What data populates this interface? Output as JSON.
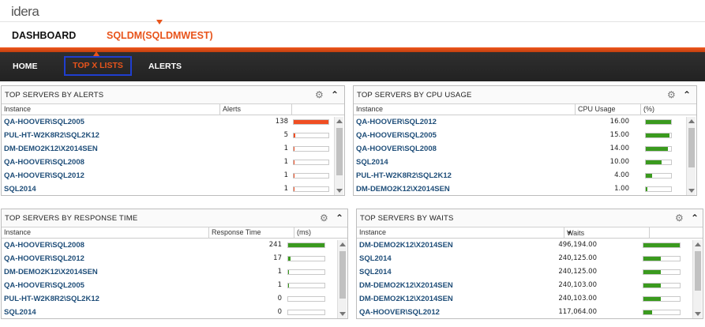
{
  "brand": {
    "logo": "idera"
  },
  "subheader": {
    "dashboard_label": "DASHBOARD",
    "instance_label": "SQLDM(SQLDMWEST)"
  },
  "nav": {
    "home": "HOME",
    "topx": "TOP X LISTS",
    "alerts": "ALERTS"
  },
  "colors": {
    "accent": "#e8541b",
    "alert_bar": "#f04e23",
    "good_bar": "#3a9a1e",
    "link": "#1f4e79"
  },
  "icons": {
    "gear": "gear-icon",
    "collapse": "chevron-up-icon",
    "sort": "sort-down-icon"
  },
  "panels": {
    "alerts": {
      "title": "TOP SERVERS BY ALERTS",
      "columns": [
        "Instance",
        "Alerts"
      ],
      "max": 138,
      "rows": [
        {
          "instance": "QA-HOOVER\\SQL2005",
          "value": "138",
          "num": 138
        },
        {
          "instance": "PUL-HT-W2K8R2\\SQL2K12",
          "value": "5",
          "num": 5
        },
        {
          "instance": "DM-DEMO2K12\\X2014SEN",
          "value": "1",
          "num": 1
        },
        {
          "instance": "QA-HOOVER\\SQL2008",
          "value": "1",
          "num": 1
        },
        {
          "instance": "QA-HOOVER\\SQL2012",
          "value": "1",
          "num": 1
        },
        {
          "instance": "SQL2014",
          "value": "1",
          "num": 1
        }
      ]
    },
    "cpu": {
      "title": "TOP SERVERS BY CPU USAGE",
      "columns": [
        "Instance",
        "CPU Usage",
        "(%)"
      ],
      "max": 16,
      "rows": [
        {
          "instance": "QA-HOOVER\\SQL2012",
          "value": "16.00",
          "num": 16
        },
        {
          "instance": "QA-HOOVER\\SQL2005",
          "value": "15.00",
          "num": 15
        },
        {
          "instance": "QA-HOOVER\\SQL2008",
          "value": "14.00",
          "num": 14
        },
        {
          "instance": "SQL2014",
          "value": "10.00",
          "num": 10
        },
        {
          "instance": "PUL-HT-W2K8R2\\SQL2K12",
          "value": "4.00",
          "num": 4
        },
        {
          "instance": "DM-DEMO2K12\\X2014SEN",
          "value": "1.00",
          "num": 1
        }
      ]
    },
    "response": {
      "title": "TOP SERVERS BY RESPONSE TIME",
      "columns": [
        "Instance",
        "Response Time",
        "(ms)"
      ],
      "max": 241,
      "rows": [
        {
          "instance": "QA-HOOVER\\SQL2008",
          "value": "241",
          "num": 241
        },
        {
          "instance": "QA-HOOVER\\SQL2012",
          "value": "17",
          "num": 17
        },
        {
          "instance": "DM-DEMO2K12\\X2014SEN",
          "value": "1",
          "num": 1
        },
        {
          "instance": "QA-HOOVER\\SQL2005",
          "value": "1",
          "num": 1
        },
        {
          "instance": "PUL-HT-W2K8R2\\SQL2K12",
          "value": "0",
          "num": 0
        },
        {
          "instance": "SQL2014",
          "value": "0",
          "num": 0
        }
      ]
    },
    "waits": {
      "title": "TOP SERVERS BY WAITS",
      "columns": [
        "Instance",
        "Waits",
        ""
      ],
      "max": 496194,
      "rows": [
        {
          "instance": "DM-DEMO2K12\\X2014SEN",
          "value": "496,194.00",
          "num": 496194
        },
        {
          "instance": "SQL2014",
          "value": "240,125.00",
          "num": 240125
        },
        {
          "instance": "SQL2014",
          "value": "240,125.00",
          "num": 240125
        },
        {
          "instance": "DM-DEMO2K12\\X2014SEN",
          "value": "240,103.00",
          "num": 240103
        },
        {
          "instance": "DM-DEMO2K12\\X2014SEN",
          "value": "240,103.00",
          "num": 240103
        },
        {
          "instance": "QA-HOOVER\\SQL2012",
          "value": "117,064.00",
          "num": 117064
        }
      ]
    }
  }
}
